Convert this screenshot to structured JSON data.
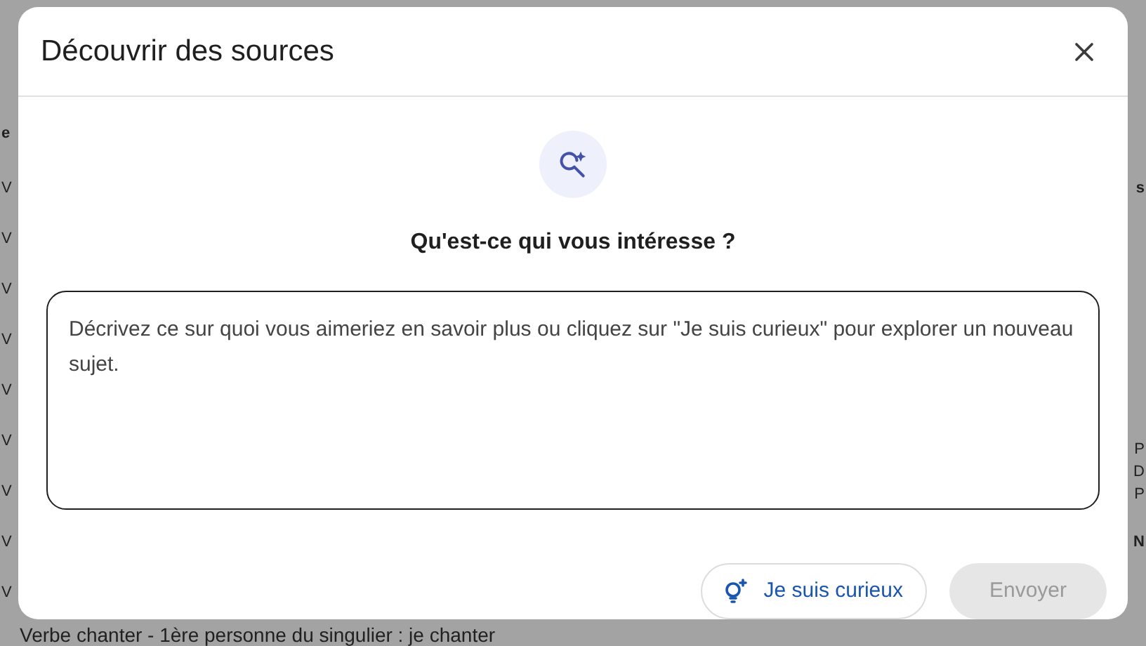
{
  "background": {
    "left_fragments": [
      "e",
      "V",
      "V",
      "V",
      "V",
      "V",
      "V",
      "V",
      "V",
      "V"
    ],
    "right_fragments": [
      "s",
      "P",
      "D",
      "P",
      "N"
    ],
    "bottom_line": "Verbe chanter - 1ère personne du singulier : je chanter"
  },
  "dialog": {
    "title": "Découvrir des sources",
    "heading": "Qu'est-ce qui vous intéresse ?",
    "prompt_field": {
      "placeholder": "Décrivez ce sur quoi vous aimeriez en savoir plus ou cliquez sur \"Je suis curieux\" pour explorer un nouveau sujet."
    },
    "buttons": [
      {
        "kind": "curious",
        "label": "Je suis curieux",
        "disabled": false
      },
      {
        "kind": "send",
        "label": "Envoyer",
        "disabled": true
      }
    ]
  }
}
